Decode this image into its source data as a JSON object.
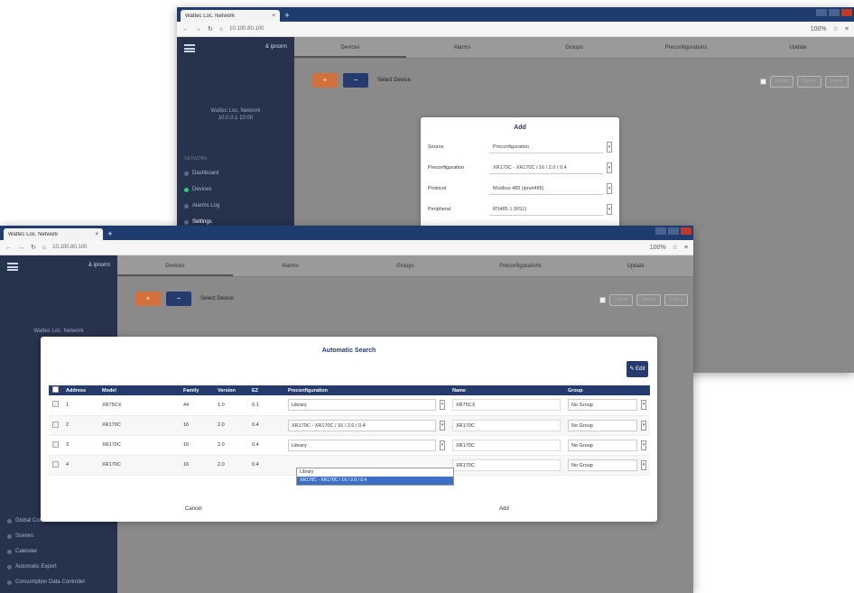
{
  "browser": {
    "tab_title": "Wattec Loc. Network",
    "new_tab": "+",
    "url": "10.100.80.100",
    "zoom": "100%"
  },
  "sidebar": {
    "user_link": "& ipnorm",
    "back_info_line1": "Wattec Loc. Network",
    "back_info_line2": "10.0.0.1 10:00",
    "front_info": "Wattec Loc. Network",
    "back_items": [
      {
        "label": "Dashboard"
      },
      {
        "label": "Devices"
      },
      {
        "label": "Alarms Log"
      },
      {
        "label": "Settings"
      }
    ],
    "back_section": "NETWORK",
    "front_items": [
      {
        "label": "Global Commands"
      },
      {
        "label": "Scenes"
      },
      {
        "label": "Calendar"
      },
      {
        "label": "Automatic Export"
      },
      {
        "label": "Consumption Data Controller"
      }
    ]
  },
  "tabs": [
    "Devices",
    "Alarms",
    "Groups",
    "Preconfigurations",
    "Update"
  ],
  "toolbar": {
    "add": "+",
    "remove": "−",
    "select_label": "Select Device",
    "btn_delete": "Delete",
    "btn_export": "Export",
    "btn_import": "Import"
  },
  "add_dialog": {
    "title": "Add",
    "fields": [
      {
        "label": "Source",
        "value": "Preconfiguration"
      },
      {
        "label": "Preconfiguration",
        "value": "XR170C - XR170C / 16 / 2.0 / 0.4"
      },
      {
        "label": "Protocol",
        "value": "Modbus 485 (ipnet485)"
      },
      {
        "label": "Peripheral",
        "value": "RS485 1 (RS1)"
      }
    ]
  },
  "search_dialog": {
    "title": "Automatic Search",
    "edit_label": "✎ Edit",
    "columns": [
      "Address",
      "Model",
      "Family",
      "Version",
      "EZ",
      "Preconfiguration",
      "Name",
      "Group"
    ],
    "rows": [
      {
        "address": "1",
        "model": "XR75CX",
        "family": "44",
        "version": "1.0",
        "ez": "0.1",
        "preconfig": "Library",
        "name": "XR75CX",
        "group": "No Group"
      },
      {
        "address": "2",
        "model": "XR170C",
        "family": "16",
        "version": "2.0",
        "ez": "0.4",
        "preconfig": "XR170C - XR170C / 16 / 2.0 / 0.4",
        "name": "XR170C",
        "group": "No Group"
      },
      {
        "address": "3",
        "model": "XR170C",
        "family": "16",
        "version": "2.0",
        "ez": "0.4",
        "preconfig": "Library",
        "name": "XR170C",
        "group": "No Group"
      },
      {
        "address": "4",
        "model": "XR170C",
        "family": "16",
        "version": "2.0",
        "ez": "0.4",
        "preconfig": "",
        "name": "XR170C",
        "group": "No Group"
      }
    ],
    "dropdown_options": [
      "Library",
      "XR170C - XR170C / 16 / 2.0 / 0.4"
    ],
    "cancel": "Cancel",
    "add": "Add"
  }
}
